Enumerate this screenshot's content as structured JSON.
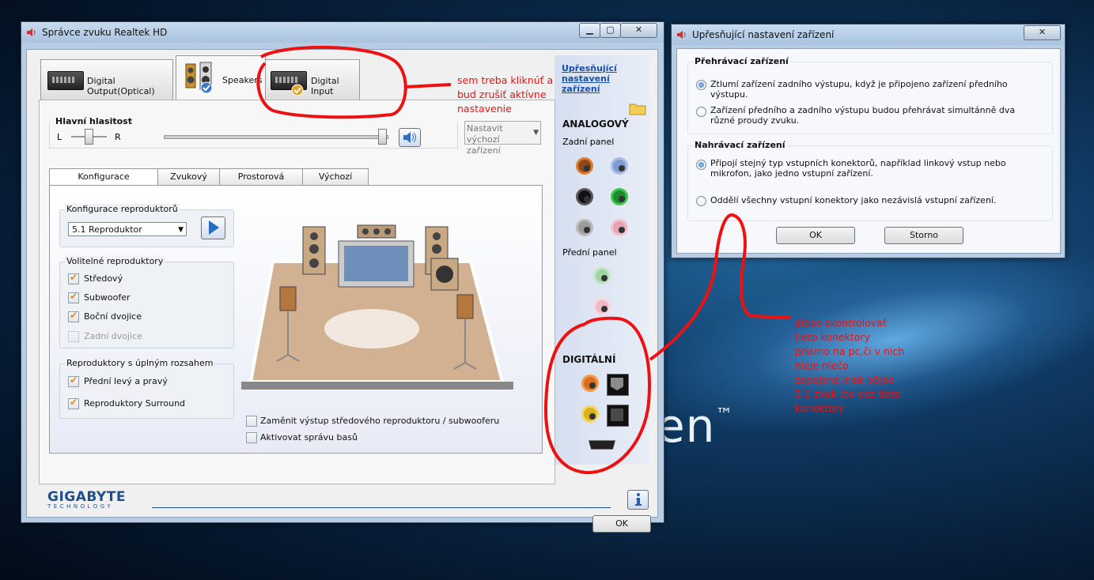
{
  "main_window": {
    "title": "Správce zvuku Realtek HD",
    "device_tabs": [
      {
        "label": "Digital Output(Optical)"
      },
      {
        "label": "Speakers"
      },
      {
        "label": "Digital Input"
      }
    ],
    "advanced_link": "Upřesňující nastavení zařízení",
    "master_volume": {
      "title": "Hlavní hlasitost",
      "left_label": "L",
      "right_label": "R",
      "default_device_label": "Nastavit výchozí zařízení"
    },
    "subtabs": [
      "Konfigurace reproduktorů",
      "Zvukový efekt",
      "Prostorová korekce",
      "Výchozí formát"
    ],
    "speaker_config": {
      "group_title": "Konfigurace reproduktorů",
      "selected": "5.1 Reproduktor"
    },
    "optional_speakers": {
      "title": "Volitelné reproduktory",
      "items": [
        {
          "label": "Středový",
          "checked": true,
          "enabled": true
        },
        {
          "label": "Subwoofer",
          "checked": true,
          "enabled": true
        },
        {
          "label": "Boční dvojice",
          "checked": true,
          "enabled": true
        },
        {
          "label": "Zadní dvojice",
          "checked": false,
          "enabled": false
        }
      ]
    },
    "full_range": {
      "title": "Reproduktory s úplným rozsahem",
      "items": [
        {
          "label": "Přední levý a pravý",
          "checked": true
        },
        {
          "label": "Reproduktory Surround",
          "checked": true
        }
      ]
    },
    "bottom_options": [
      {
        "label": "Zaměnit výstup středového reproduktoru / subwooferu",
        "checked": false
      },
      {
        "label": "Aktivovat správu basů",
        "checked": false
      }
    ],
    "jacks": {
      "analog_title": "ANALOGOVÝ",
      "rear_panel": "Zadní panel",
      "front_panel": "Přední panel",
      "digital_title": "DIGITÁLNÍ"
    },
    "brand": {
      "name": "GIGABYTE",
      "sub": "TECHNOLOGY"
    },
    "ok_label": "OK"
  },
  "advanced_window": {
    "title": "Upřesňující nastavení zařízení",
    "playback": {
      "title": "Přehrávací zařízení",
      "options": [
        {
          "label": "Ztlumí zařízení zadního výstupu, když je připojeno zařízení předního výstupu.",
          "selected": true
        },
        {
          "label": "Zařízení předního a zadního výstupu budou přehrávat simultánně dva různé proudy zvuku.",
          "selected": false
        }
      ]
    },
    "recording": {
      "title": "Nahrávací zařízení",
      "options": [
        {
          "label": "Připojí stejný typ vstupních konektorů, například linkový vstup nebo mikrofon, jako jedno vstupní zařízení.",
          "selected": true
        },
        {
          "label": "Oddělí všechny vstupní konektory jako nezávislá vstupní zařízení.",
          "selected": false
        }
      ]
    },
    "ok_label": "OK",
    "cancel_label": "Storno"
  },
  "annotations": {
    "note1": "sem treba kliknúť a bud zrušiť aktívne nastavenie",
    "note2": "alebo skontrolovať tieto konektory priamo na pc,či v nich nieje niečo zapojené,inak pôjde 5.1 zvuk iba cez tieto konektory"
  },
  "desktop_text": "en",
  "colors": {
    "annotation": "#e11111",
    "link": "#1a4fa8",
    "accent_check": "#e0882a"
  }
}
